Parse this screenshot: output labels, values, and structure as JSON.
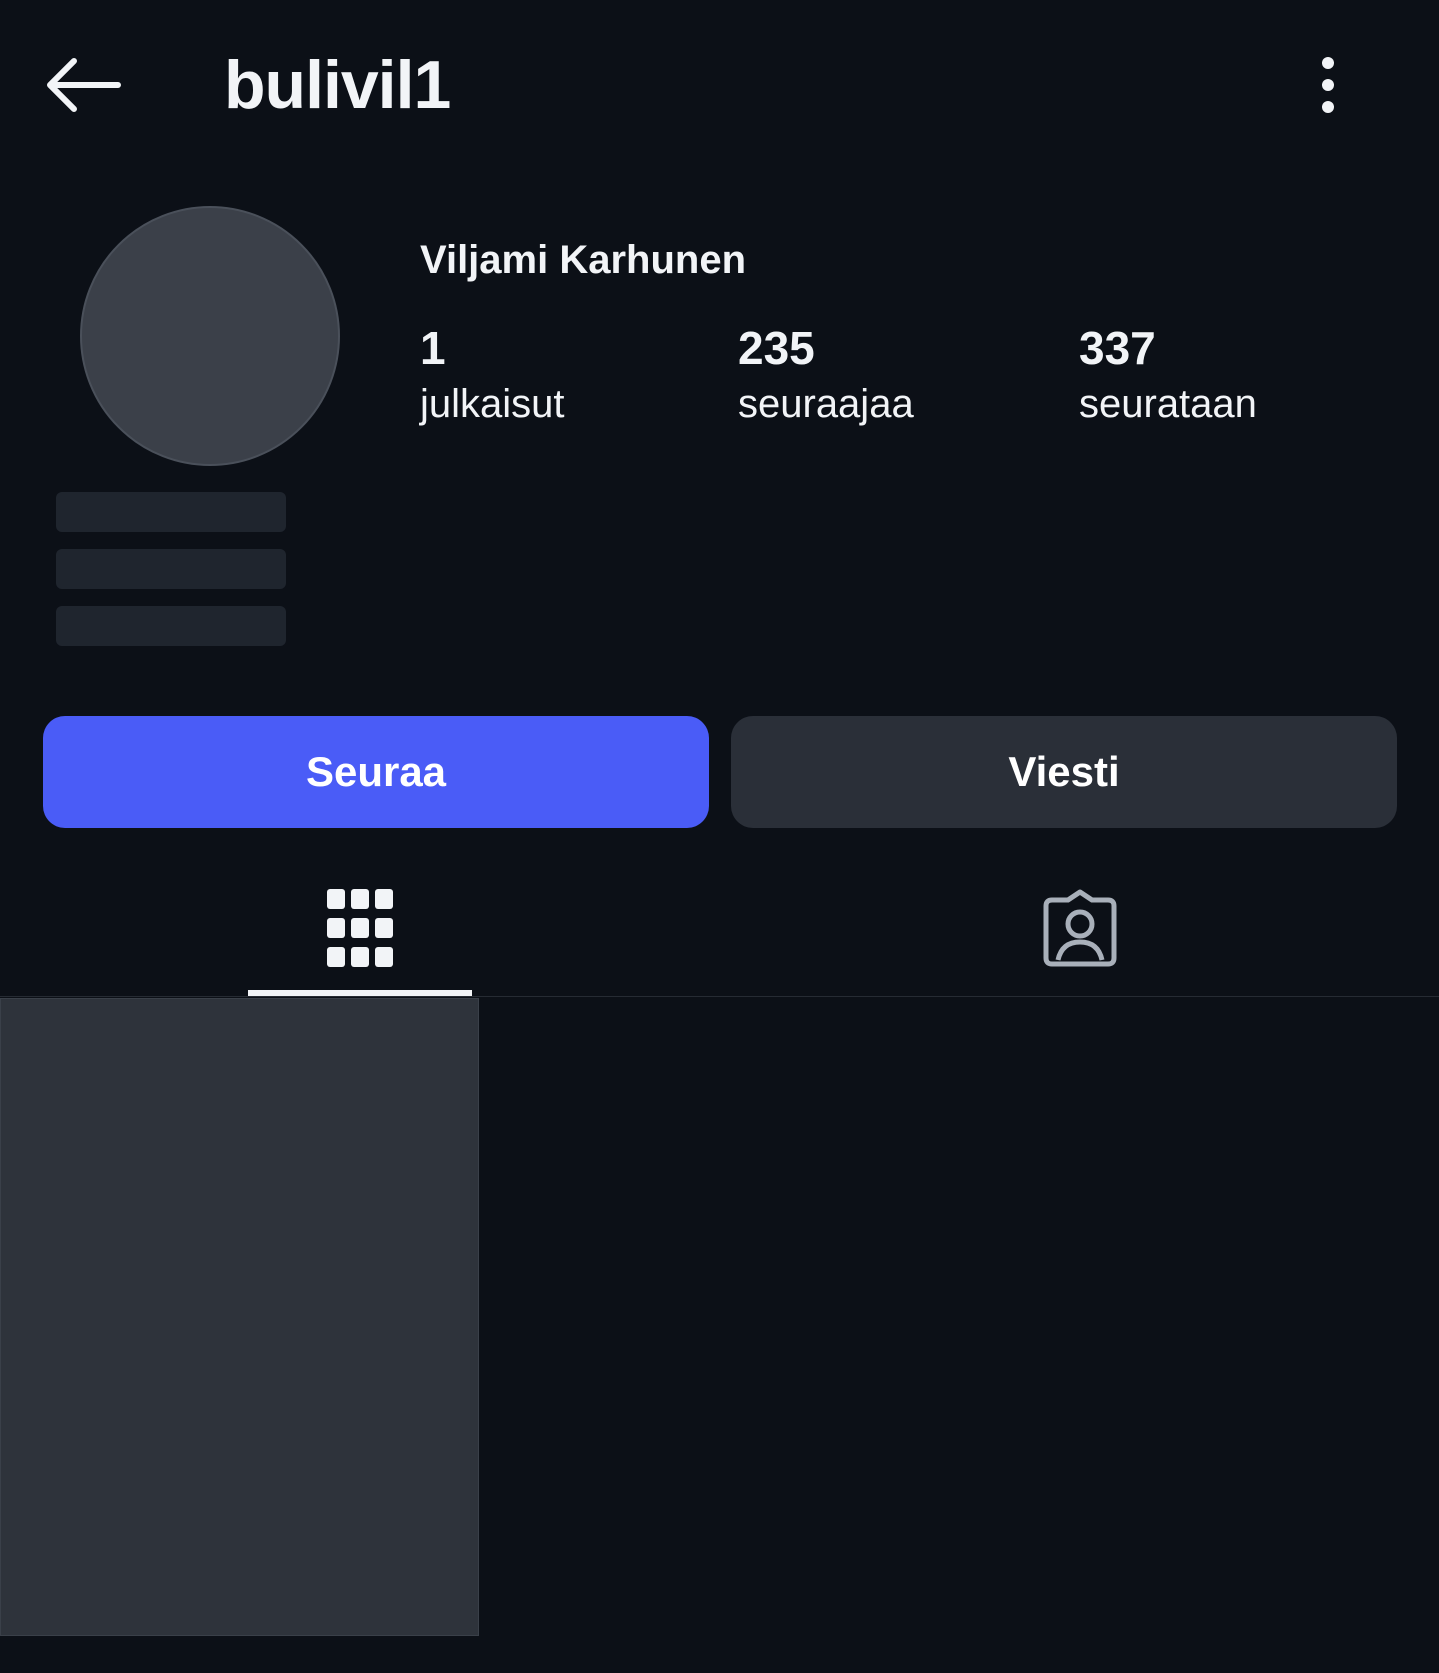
{
  "header": {
    "handle": "bulivil1"
  },
  "profile": {
    "display_name": "Viljami Karhunen",
    "stats": [
      {
        "count": "1",
        "label": "julkaisut"
      },
      {
        "count": "235",
        "label": "seuraajaa"
      },
      {
        "count": "337",
        "label": "seurataan"
      }
    ]
  },
  "actions": {
    "follow_label": "Seuraa",
    "message_label": "Viesti"
  },
  "colors": {
    "background": "#0c1017",
    "follow_button": "#4a5cf7",
    "message_button": "#2a2f38"
  },
  "icons": [
    "back-arrow-icon",
    "more-options-icon",
    "grid-icon",
    "tagged-icon"
  ]
}
